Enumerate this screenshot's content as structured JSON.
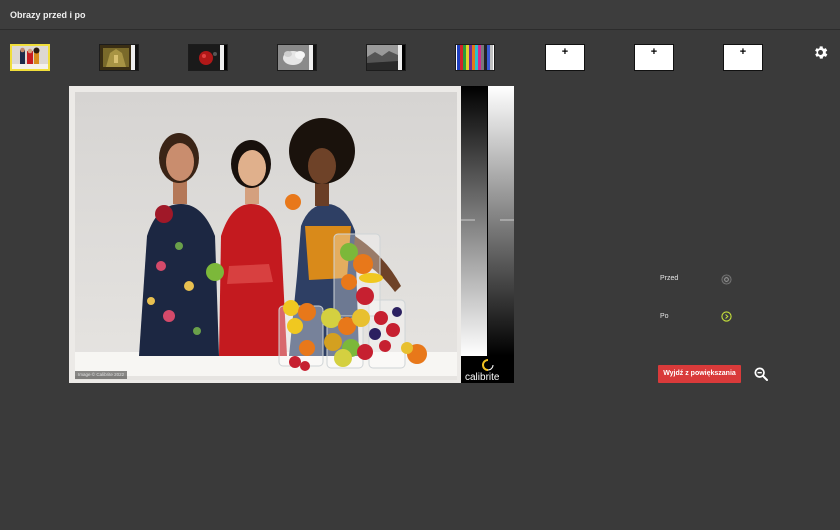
{
  "window": {
    "title": "Obrazy przed i po"
  },
  "thumbnails": [
    {
      "id": "group-portrait",
      "kind": "image",
      "selected": true
    },
    {
      "id": "interior",
      "kind": "image",
      "selected": false
    },
    {
      "id": "red-object",
      "kind": "image",
      "selected": false
    },
    {
      "id": "white-objects",
      "kind": "image",
      "selected": false
    },
    {
      "id": "bw-landscape",
      "kind": "image",
      "selected": false
    },
    {
      "id": "color-bars",
      "kind": "image",
      "selected": false
    },
    {
      "id": "empty-1",
      "kind": "empty",
      "label": "+"
    },
    {
      "id": "empty-2",
      "kind": "empty",
      "label": "+"
    },
    {
      "id": "empty-3",
      "kind": "empty",
      "label": "+"
    }
  ],
  "viewer": {
    "copyright": "Image © Calibrite 2022",
    "brand": "calibrite"
  },
  "controls": {
    "before_label": "Przed",
    "after_label": "Po",
    "selected": "Po",
    "exit_zoom_label": "Wyjdź z powiększania"
  },
  "icons": {
    "settings": "gear-icon",
    "zoom_out": "zoom-out-icon",
    "add": "plus-icon"
  },
  "colors": {
    "background": "#3a3a3a",
    "selected_outline": "#f0de3a",
    "radio_selected": "#c6e23a",
    "exit_button": "#d93a3a"
  }
}
